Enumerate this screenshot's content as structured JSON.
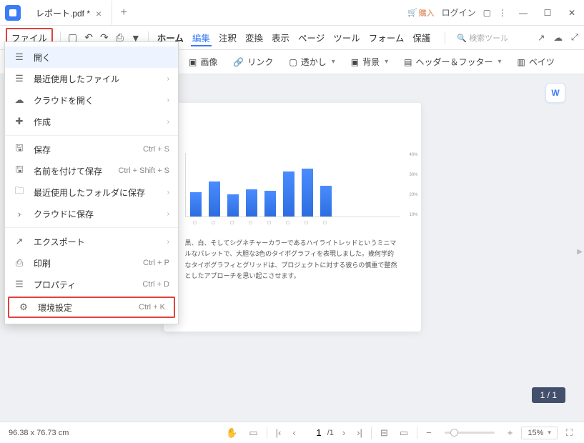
{
  "titlebar": {
    "tab_title": "レポート.pdf *",
    "buy": "購入",
    "login": "ログイン"
  },
  "toolbar": {
    "file": "ファイル",
    "menus": [
      "ホーム",
      "編集",
      "注釈",
      "変換",
      "表示",
      "ページ",
      "ツール",
      "フォーム",
      "保護"
    ],
    "active_menu": "編集",
    "search_placeholder": "検索ツール"
  },
  "subtoolbar": {
    "image": "画像",
    "link": "リンク",
    "watermark": "透かし",
    "background": "背景",
    "header_footer": "ヘッダー＆フッター",
    "bates": "ベイツ"
  },
  "dropdown": {
    "items": [
      {
        "icon": "☰",
        "label": "開く",
        "shortcut": "",
        "sub": "",
        "hover": true
      },
      {
        "icon": "☰",
        "label": "最近使用したファイル",
        "shortcut": "",
        "sub": "›"
      },
      {
        "icon": "☁",
        "label": "クラウドを開く",
        "shortcut": "",
        "sub": "›"
      },
      {
        "icon": "✚",
        "label": "作成",
        "shortcut": "",
        "sub": "›"
      },
      {
        "divider": true
      },
      {
        "icon": "🖫",
        "label": "保存",
        "shortcut": "Ctrl + S",
        "sub": ""
      },
      {
        "icon": "🖫",
        "label": "名前を付けて保存",
        "shortcut": "Ctrl + Shift + S",
        "sub": ""
      },
      {
        "icon": "🗀",
        "label": "最近使用したフォルダに保存",
        "shortcut": "",
        "sub": "›"
      },
      {
        "icon": "›",
        "label": "クラウドに保存",
        "shortcut": "",
        "sub": "›"
      },
      {
        "divider": true
      },
      {
        "icon": "↗",
        "label": "エクスポート",
        "shortcut": "",
        "sub": "›"
      },
      {
        "icon": "⎙",
        "label": "印刷",
        "shortcut": "Ctrl + P",
        "sub": ""
      },
      {
        "icon": "☰",
        "label": "プロパティ",
        "shortcut": "Ctrl + D",
        "sub": ""
      },
      {
        "icon": "⚙",
        "label": "環境設定",
        "shortcut": "Ctrl + K",
        "sub": "",
        "highlight": true
      }
    ]
  },
  "page": {
    "text": "黒、白、そしてシグネチャーカラーであるハイライトレッドというミニマルなパレットで、大胆な3色のタイポグラフィを表現しました。幾何学的なタイポグラフィとグリッドは、プロジェクトに対する彼らの慎重で整然としたアプローチを思い起こさせます。"
  },
  "page_indicator": "1 / 1",
  "float_badge": "W",
  "statusbar": {
    "dimensions": "96.38 x 76.73 cm",
    "page_current": "1",
    "page_total": "/1",
    "zoom": "15%"
  },
  "chart_data": {
    "type": "bar",
    "categories": [
      "b1",
      "b2",
      "b3",
      "b4",
      "b5",
      "b6",
      "b7",
      "b8"
    ],
    "values": [
      38,
      55,
      35,
      42,
      40,
      70,
      75,
      48
    ],
    "y_ticks": [
      "40%",
      "30%",
      "20%",
      "10%"
    ],
    "xlabel": "",
    "ylabel": "",
    "ylim": [
      0,
      100
    ]
  }
}
